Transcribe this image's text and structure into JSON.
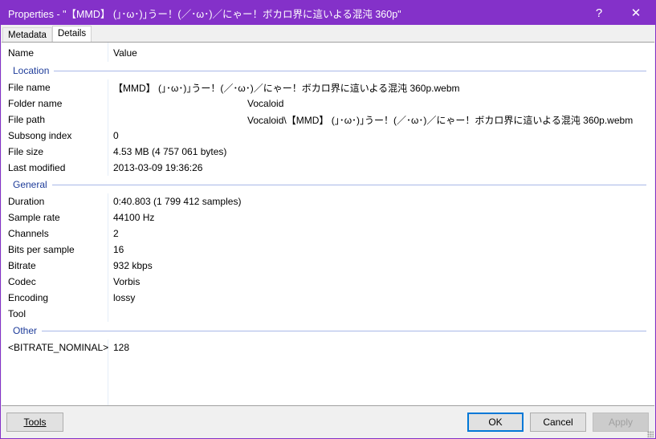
{
  "window": {
    "title": "Properties - \"【MMD】 (｣･ω･)｣うー！(／･ω･)／にゃー！ボカロ界に這いよる混沌 360p\"",
    "help": "?",
    "close": "✕"
  },
  "tabs": [
    {
      "label": "Metadata"
    },
    {
      "label": "Details"
    }
  ],
  "columns": {
    "name": "Name",
    "value": "Value"
  },
  "groups": [
    {
      "label": "Location",
      "rows": [
        {
          "name": "File name",
          "value": "【MMD】 (｣･ω･)｣うー！(／･ω･)／にゃー！ボカロ界に這いよる混沌 360p.webm"
        },
        {
          "name": "Folder name",
          "value": "Vocaloid"
        },
        {
          "name": "File path",
          "value": "Vocaloid\\【MMD】 (｣･ω･)｣うー！(／･ω･)／にゃー！ボカロ界に這いよる混沌 360p.webm"
        },
        {
          "name": "Subsong index",
          "value": "0"
        },
        {
          "name": "File size",
          "value": "4.53 MB (4 757 061 bytes)"
        },
        {
          "name": "Last modified",
          "value": "2013-03-09 19:36:26"
        }
      ]
    },
    {
      "label": "General",
      "rows": [
        {
          "name": "Duration",
          "value": "0:40.803 (1 799 412 samples)"
        },
        {
          "name": "Sample rate",
          "value": "44100 Hz"
        },
        {
          "name": "Channels",
          "value": "2"
        },
        {
          "name": "Bits per sample",
          "value": "16"
        },
        {
          "name": "Bitrate",
          "value": "932 kbps"
        },
        {
          "name": "Codec",
          "value": "Vorbis"
        },
        {
          "name": "Encoding",
          "value": "lossy"
        },
        {
          "name": "Tool",
          "value": ""
        }
      ]
    },
    {
      "label": "Other",
      "rows": [
        {
          "name": "<BITRATE_NOMINAL>",
          "value": "128"
        }
      ]
    }
  ],
  "buttons": {
    "tools": "Tools",
    "ok": "OK",
    "cancel": "Cancel",
    "apply": "Apply"
  }
}
